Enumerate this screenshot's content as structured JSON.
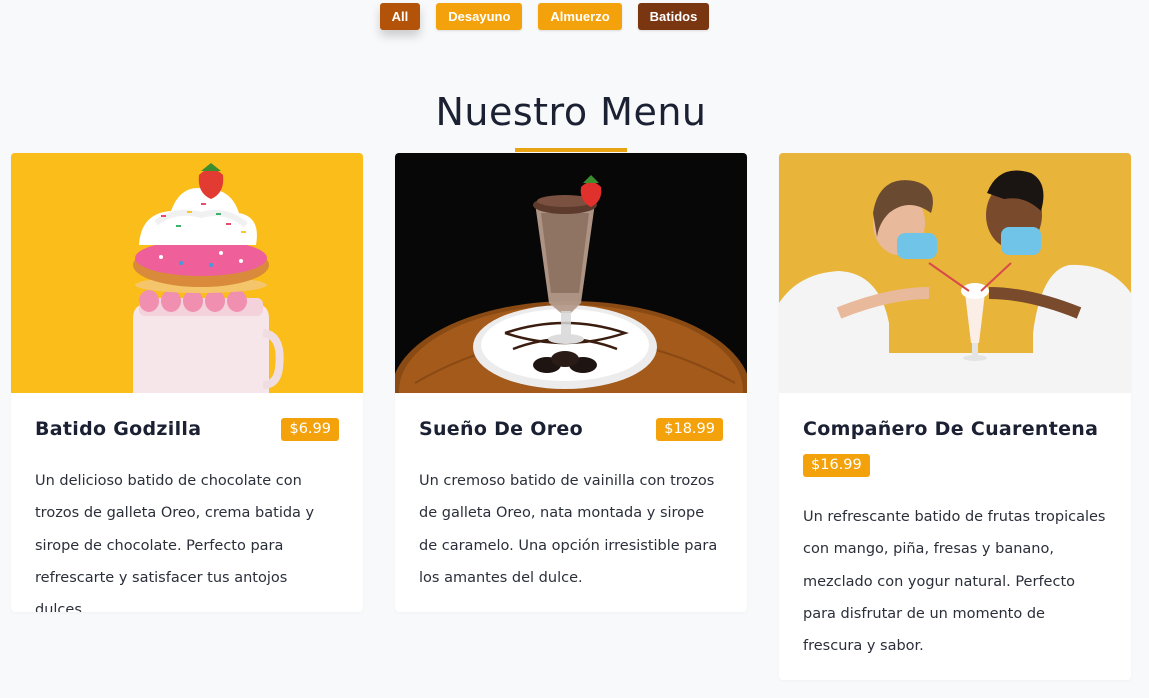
{
  "filters": [
    {
      "label": "All"
    },
    {
      "label": "Desayuno"
    },
    {
      "label": "Almuerzo"
    },
    {
      "label": "Batidos"
    }
  ],
  "section": {
    "title": "Nuestro Menu"
  },
  "colors": {
    "accent": "#f3a20c",
    "active": "#7a3511",
    "all": "#b35309"
  },
  "items": [
    {
      "name": "Batido Godzilla",
      "price": "$6.99",
      "image": "freakshake-on-yellow",
      "description": "Un delicioso batido de chocolate con trozos de galleta Oreo, crema batida y sirope de chocolate. Perfecto para refrescarte y satisfacer tus antojos dulces."
    },
    {
      "name": "Sueño De Oreo",
      "price": "$18.99",
      "image": "oreo-milkshake-glass",
      "description": "Un cremoso batido de vainilla con trozos de galleta Oreo, nata montada y sirope de caramelo. Una opción irresistible para los amantes del dulce."
    },
    {
      "name": "Compañero De Cuarentena",
      "price": "$16.99",
      "image": "couple-sharing-milkshake",
      "description": "Un refrescante batido de frutas tropicales con mango, piña, fresas y banano, mezclado con yogur natural. Perfecto para disfrutar de un momento de frescura y sabor."
    }
  ]
}
